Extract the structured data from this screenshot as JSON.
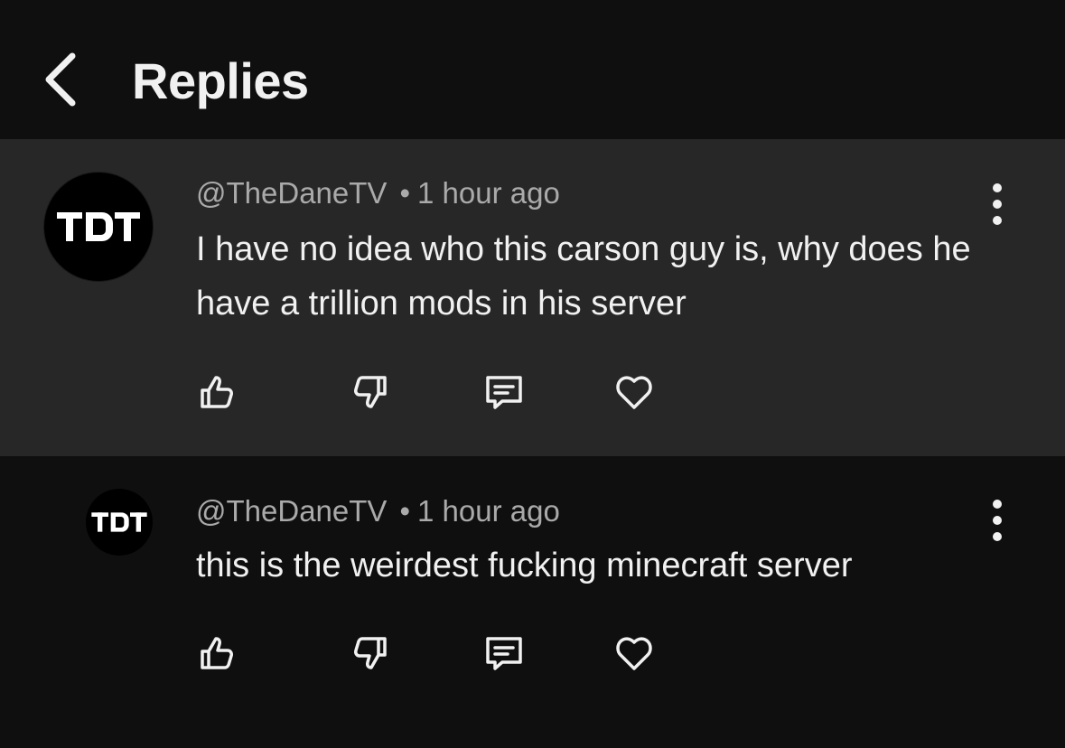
{
  "header": {
    "title": "Replies",
    "back_icon": "chevron-left-icon"
  },
  "comments": [
    {
      "avatar_text": "TDT",
      "author": "@TheDaneTV",
      "separator": "•",
      "time": "1 hour ago",
      "text": "I have no idea who this carson guy is, why does he have a trillion mods in his server",
      "actions": [
        "thumbs-up-icon",
        "thumbs-down-icon",
        "comment-icon",
        "heart-icon"
      ],
      "menu_icon": "more-vertical-icon"
    },
    {
      "avatar_text": "TDT",
      "author": "@TheDaneTV",
      "separator": "•",
      "time": "1 hour ago",
      "text": "this is the weirdest fucking minecraft server",
      "actions": [
        "thumbs-up-icon",
        "thumbs-down-icon",
        "comment-icon",
        "heart-icon"
      ],
      "menu_icon": "more-vertical-icon"
    }
  ],
  "colors": {
    "background": "#0f0f0f",
    "highlighted_comment": "#272727",
    "primary_text": "#f1f1f1",
    "secondary_text": "#aaaaaa"
  }
}
